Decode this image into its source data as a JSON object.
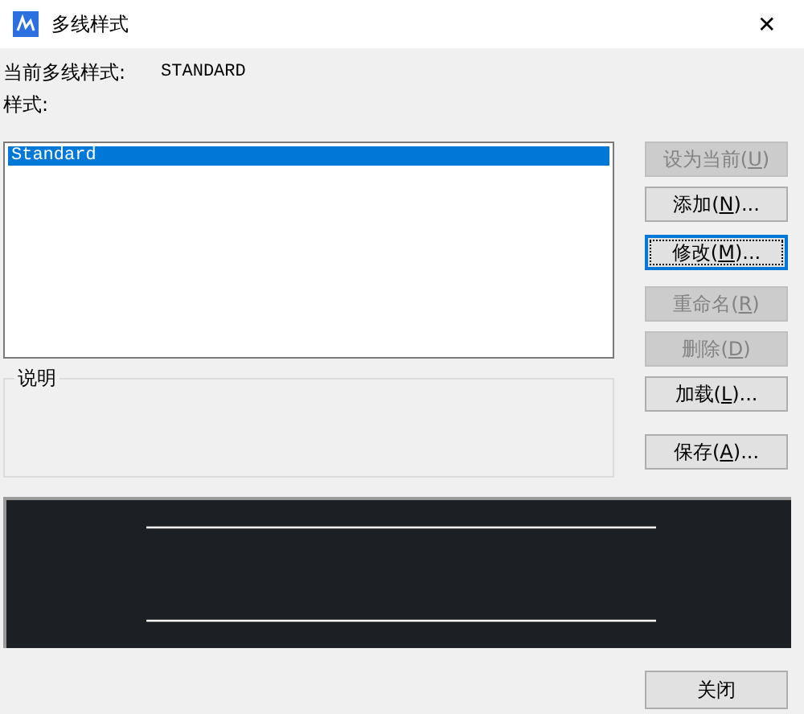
{
  "window": {
    "title": "多线样式",
    "close": "✕"
  },
  "current_style": {
    "label": "当前多线样式:",
    "value": "STANDARD"
  },
  "styles_label": "样式:",
  "styles": [
    {
      "name": "Standard",
      "selected": true
    }
  ],
  "description": {
    "legend": "说明"
  },
  "buttons": [
    {
      "before": "设为当前(",
      "key": "U",
      "after": ")",
      "disabled": true,
      "focused": false
    },
    {
      "before": "添加(",
      "key": "N",
      "after": ")...",
      "disabled": false,
      "focused": false
    },
    {
      "before": "修改(",
      "key": "M",
      "after": ")...",
      "disabled": false,
      "focused": true
    },
    {
      "before": "重命名(",
      "key": "R",
      "after": ")",
      "disabled": true,
      "focused": false
    },
    {
      "before": "删除(",
      "key": "D",
      "after": ")",
      "disabled": true,
      "focused": false
    },
    {
      "before": "加载(",
      "key": "L",
      "after": ")...",
      "disabled": false,
      "focused": false
    },
    {
      "before": "保存(",
      "key": "A",
      "after": ")...",
      "disabled": false,
      "focused": false
    }
  ],
  "close_button": "关闭"
}
